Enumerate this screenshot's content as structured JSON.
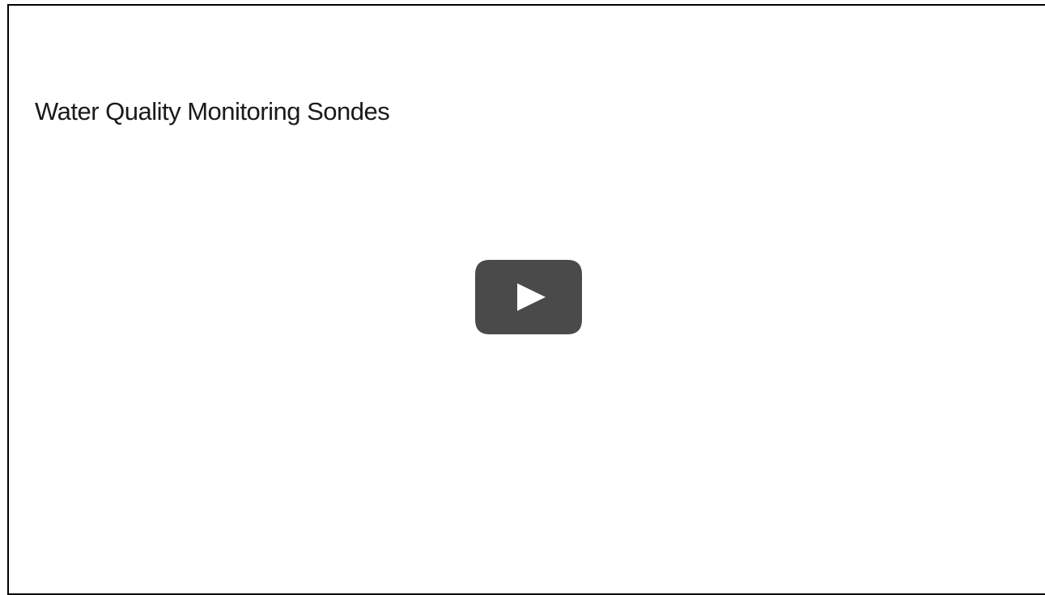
{
  "video": {
    "title": "Water Quality Monitoring Sondes"
  },
  "colors": {
    "play_button_bg": "#4a4a4a",
    "play_triangle": "#ffffff",
    "border": "#000000",
    "title_text": "#1a1a1a"
  },
  "icons": {
    "play": "play-icon"
  }
}
